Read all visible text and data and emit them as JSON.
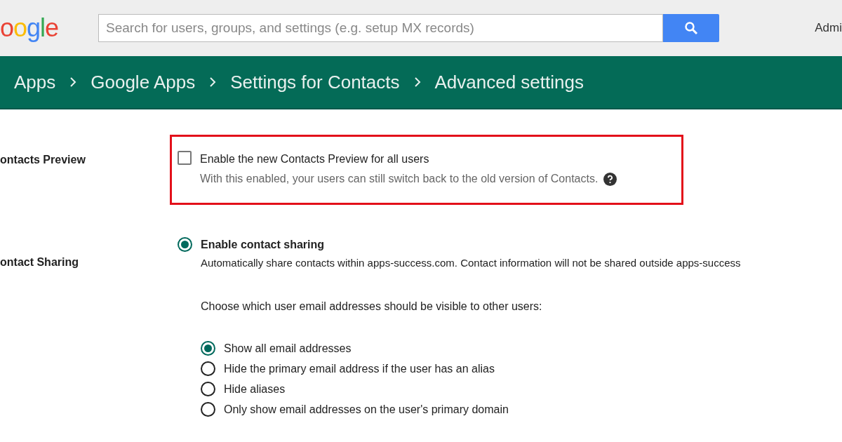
{
  "header": {
    "logo": "oogle",
    "search": {
      "placeholder": "Search for users, groups, and settings (e.g. setup MX records)"
    },
    "account": "Admi"
  },
  "breadcrumb": [
    "Apps",
    "Google Apps",
    "Settings for Contacts",
    "Advanced settings"
  ],
  "sections": [
    {
      "kind": "checkbox",
      "label": "ontacts Preview",
      "highlighted": true,
      "option": "Enable the new Contacts Preview for all users",
      "checked": false,
      "description": "With this enabled, your users can still switch back to the old version of Contacts."
    },
    {
      "kind": "radio",
      "label": "ontact Sharing",
      "option": "Enable contact sharing",
      "selected": true,
      "description": "Automatically share contacts within apps-success.com. Contact information will not be shared outside apps-success",
      "prompt": "Choose which user email addresses should be visible to other users:",
      "choices": [
        {
          "label": "Show all email addresses",
          "selected": true
        },
        {
          "label": "Hide the primary email address if the user has an alias",
          "selected": false
        },
        {
          "label": "Hide aliases",
          "selected": false
        },
        {
          "label": "Only show email addresses on the user's primary domain",
          "selected": false
        }
      ]
    }
  ]
}
